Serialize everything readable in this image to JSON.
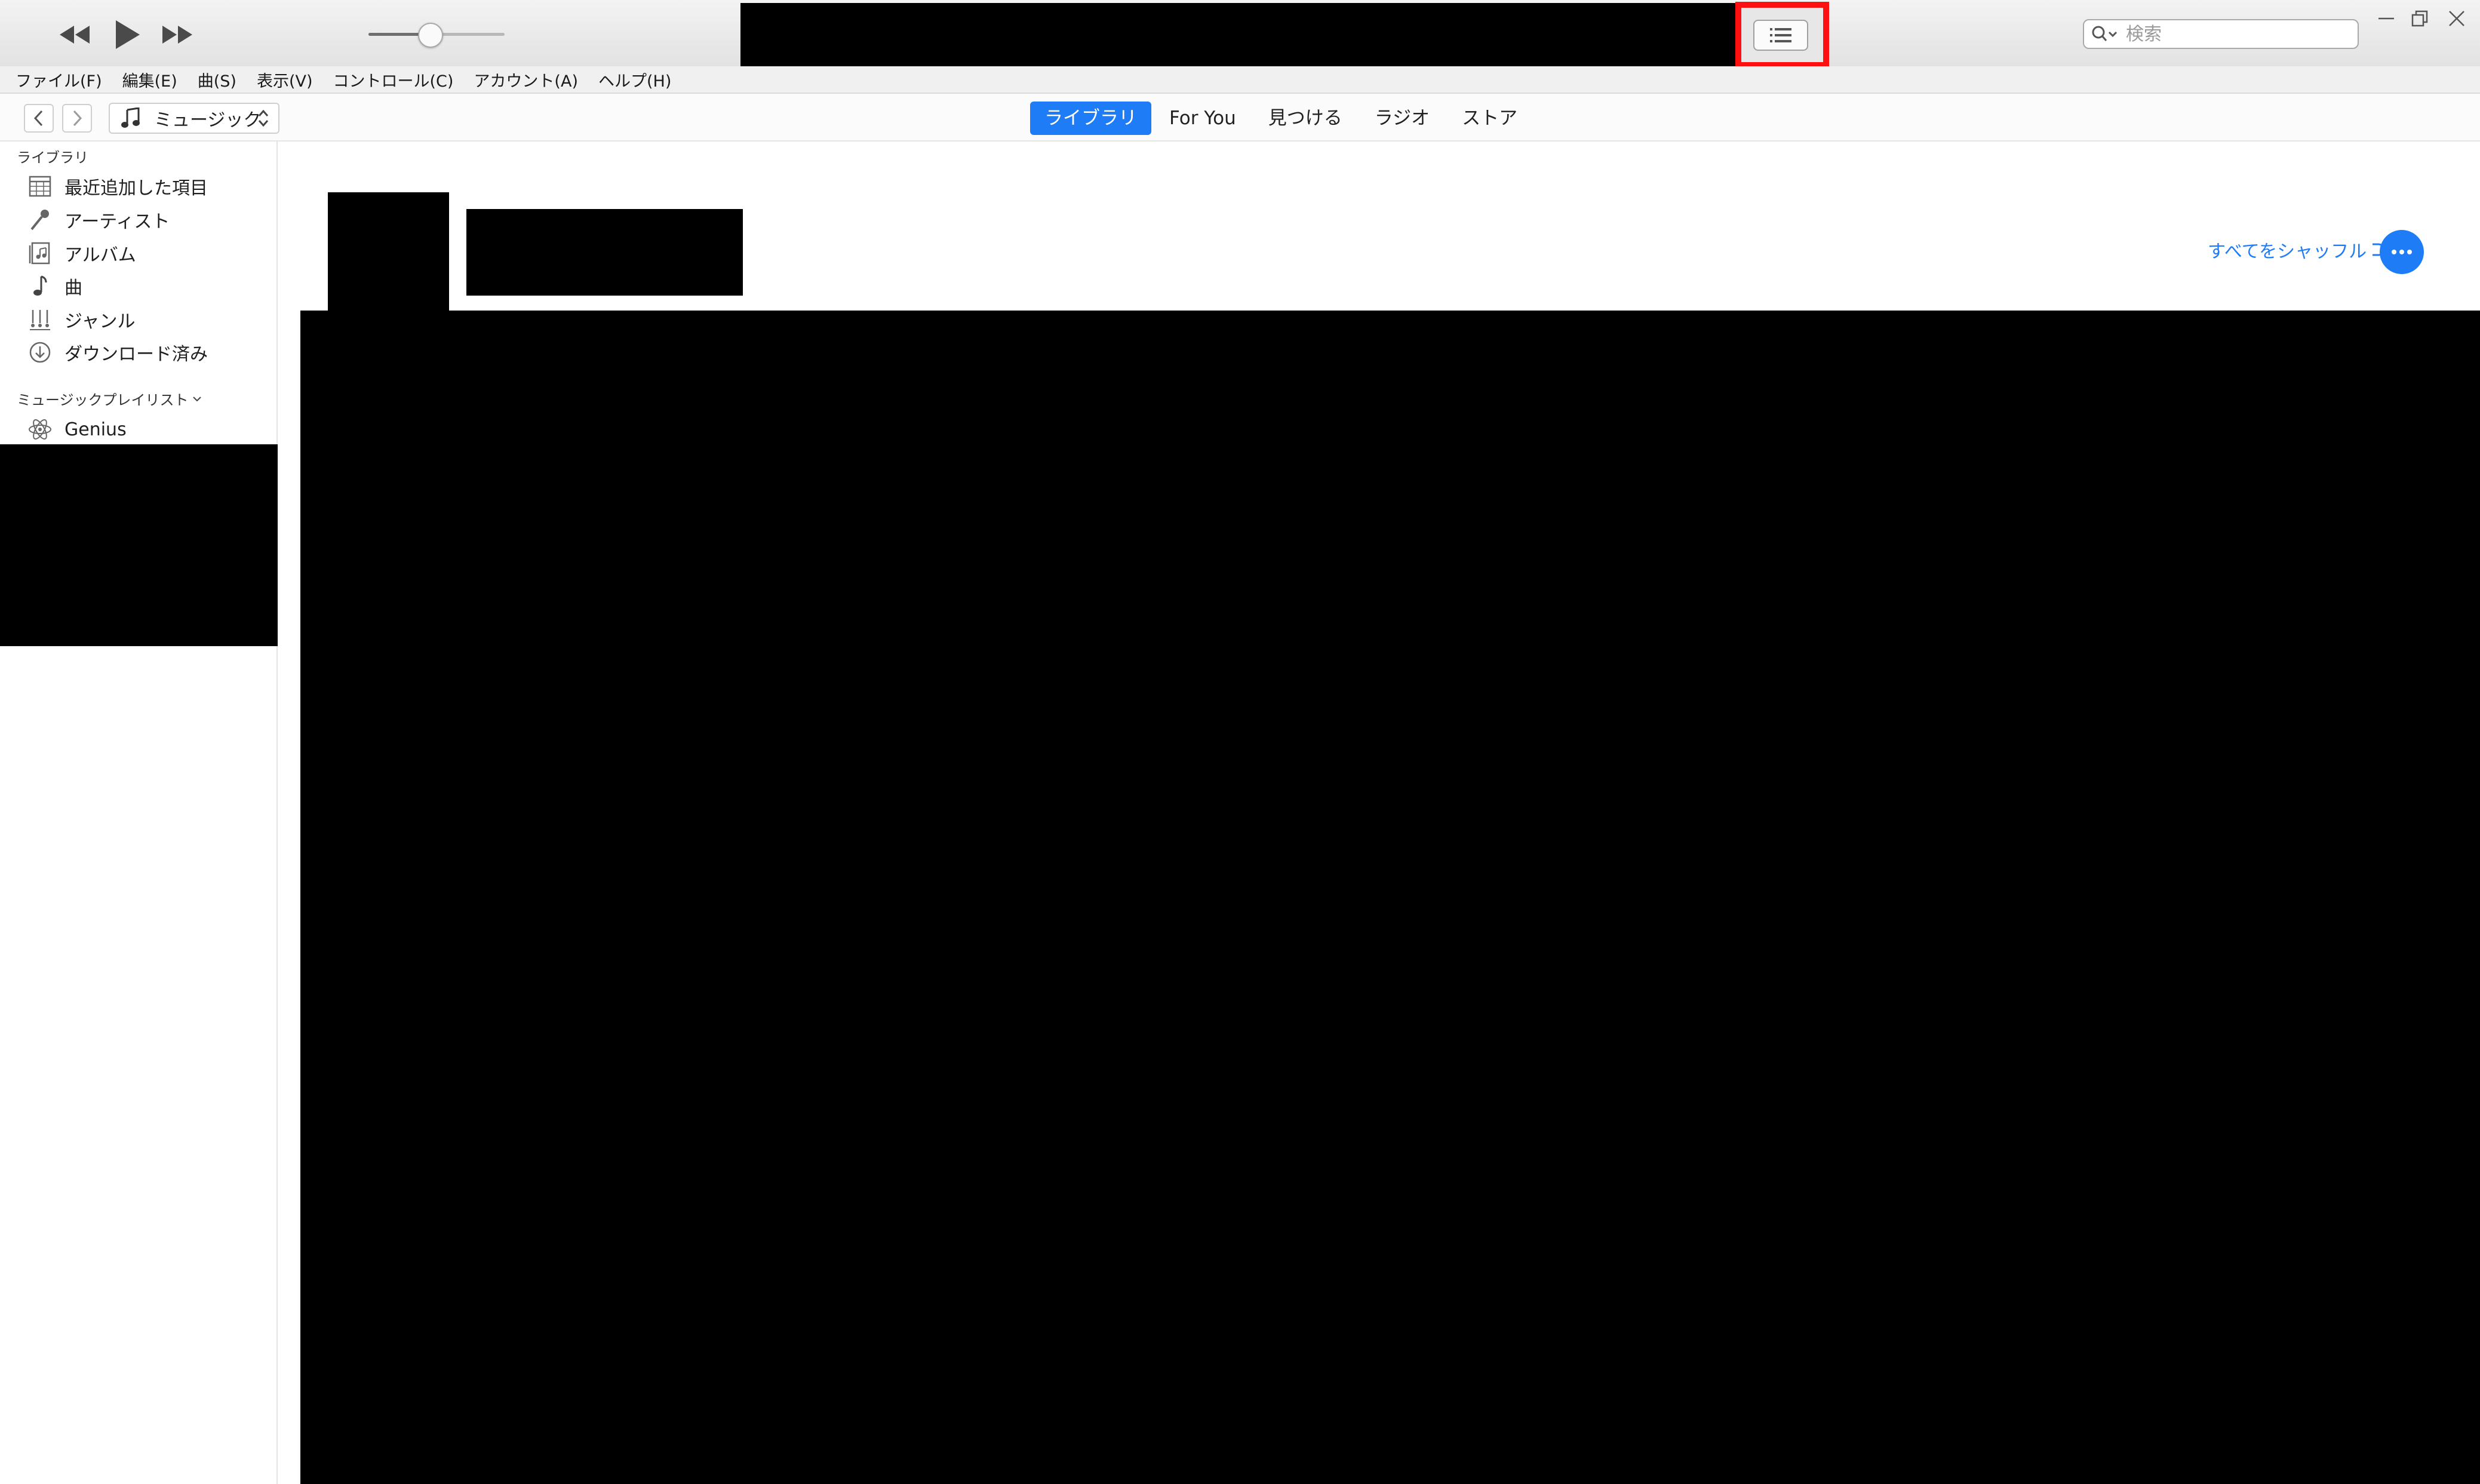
{
  "search": {
    "placeholder": "検索"
  },
  "menu": [
    "ファイル(F)",
    "編集(E)",
    "曲(S)",
    "表示(V)",
    "コントロール(C)",
    "アカウント(A)",
    "ヘルプ(H)"
  ],
  "media_picker": {
    "label": "ミュージック"
  },
  "tabs": [
    "ライブラリ",
    "For You",
    "見つける",
    "ラジオ",
    "ストア"
  ],
  "active_tab": "ライブラリ",
  "sidebar": {
    "library_header": "ライブラリ",
    "library_items": [
      {
        "label": "最近追加した項目",
        "icon": "calendar-grid-icon"
      },
      {
        "label": "アーティスト",
        "icon": "microphone-icon"
      },
      {
        "label": "アルバム",
        "icon": "album-icon"
      },
      {
        "label": "曲",
        "icon": "music-note-icon"
      },
      {
        "label": "ジャンル",
        "icon": "genre-icon"
      },
      {
        "label": "ダウンロード済み",
        "icon": "download-icon"
      }
    ],
    "playlists_header": "ミュージックプレイリスト",
    "playlist_items": [
      {
        "label": "Genius",
        "icon": "genius-atom-icon"
      }
    ]
  },
  "main": {
    "shuffle_label": "すべてをシャッフル"
  },
  "colors": {
    "accent": "#1e7df6",
    "highlight": "#ff1010"
  }
}
